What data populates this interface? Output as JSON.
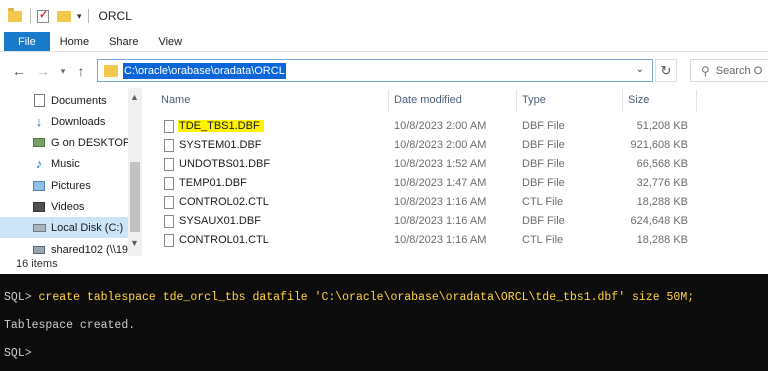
{
  "window": {
    "title": "ORCL"
  },
  "ribbon": {
    "tabs": [
      "File",
      "Home",
      "Share",
      "View"
    ]
  },
  "address": {
    "path": "C:\\oracle\\orabase\\oradata\\ORCL",
    "search_placeholder": "Search O"
  },
  "navpane": {
    "items": [
      {
        "label": "Documents",
        "icon": "documents-icon"
      },
      {
        "label": "Downloads",
        "icon": "downloads-icon"
      },
      {
        "label": "G on DESKTOP-E",
        "icon": "network-drive-icon"
      },
      {
        "label": "Music",
        "icon": "music-icon"
      },
      {
        "label": "Pictures",
        "icon": "pictures-icon"
      },
      {
        "label": "Videos",
        "icon": "videos-icon"
      },
      {
        "label": "Local Disk (C:)",
        "icon": "local-disk-icon",
        "selected": true
      },
      {
        "label": "shared102 (\\\\19",
        "icon": "network-share-icon"
      }
    ]
  },
  "filelist": {
    "columns": [
      "Name",
      "Date modified",
      "Type",
      "Size"
    ],
    "rows": [
      {
        "name": "TDE_TBS1.DBF",
        "date": "10/8/2023 2:00 AM",
        "type": "DBF File",
        "size": "51,208 KB",
        "highlighted": true
      },
      {
        "name": "SYSTEM01.DBF",
        "date": "10/8/2023 2:00 AM",
        "type": "DBF File",
        "size": "921,608 KB"
      },
      {
        "name": "UNDOTBS01.DBF",
        "date": "10/8/2023 1:52 AM",
        "type": "DBF File",
        "size": "66,568 KB"
      },
      {
        "name": "TEMP01.DBF",
        "date": "10/8/2023 1:47 AM",
        "type": "DBF File",
        "size": "32,776 KB"
      },
      {
        "name": "CONTROL02.CTL",
        "date": "10/8/2023 1:16 AM",
        "type": "CTL File",
        "size": "18,288 KB"
      },
      {
        "name": "SYSAUX01.DBF",
        "date": "10/8/2023 1:16 AM",
        "type": "DBF File",
        "size": "624,648 KB"
      },
      {
        "name": "CONTROL01.CTL",
        "date": "10/8/2023 1:16 AM",
        "type": "CTL File",
        "size": "18,288 KB"
      }
    ]
  },
  "status": {
    "count": "16 items"
  },
  "console": {
    "prompt": "SQL>",
    "command": " create tablespace tde_orcl_tbs datafile 'C:\\oracle\\orabase\\oradata\\ORCL\\tde_tbs1.dbf' size 50M;",
    "output": "Tablespace created."
  },
  "colors": {
    "file_tab": "#1979ca",
    "highlight": "#fff200",
    "command_text": "#ffd43b",
    "console_bg": "#0c0c0c"
  }
}
